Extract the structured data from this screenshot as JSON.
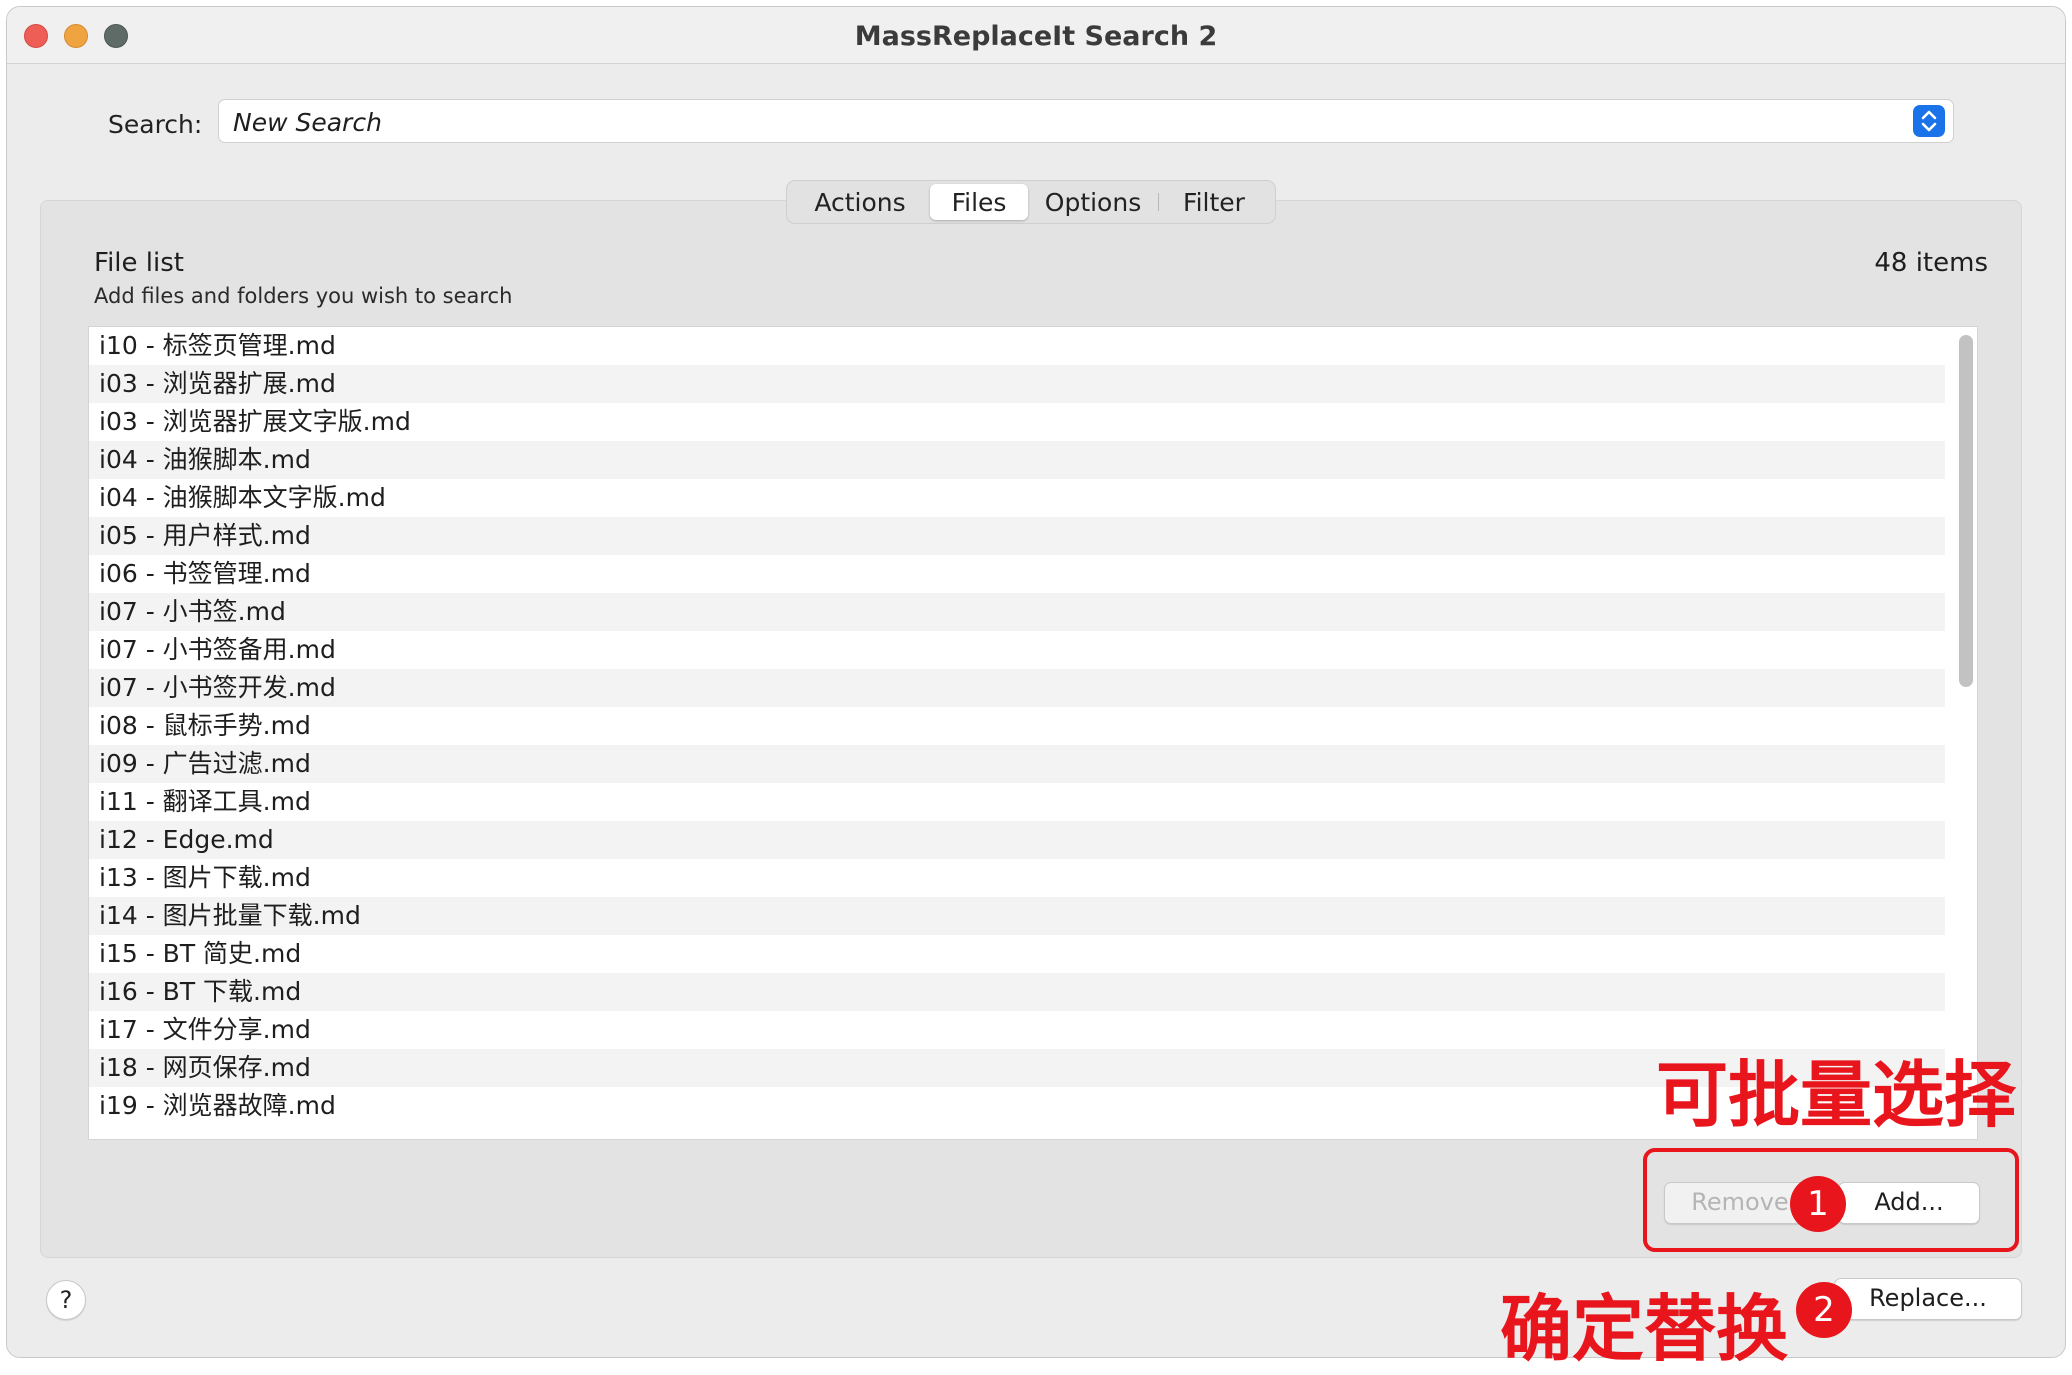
{
  "window": {
    "title": "MassReplaceIt Search 2"
  },
  "search": {
    "label": "Search:",
    "value": "New Search"
  },
  "tabs": [
    {
      "label": "Actions",
      "active": false
    },
    {
      "label": "Files",
      "active": true
    },
    {
      "label": "Options",
      "active": false
    },
    {
      "label": "Filter",
      "active": false
    }
  ],
  "file_list": {
    "title": "File list",
    "subtitle": "Add files and folders you wish to search",
    "count": "48 items",
    "items": [
      "i10 - 标签页管理.md",
      "i03 - 浏览器扩展.md",
      "i03 - 浏览器扩展文字版.md",
      "i04 - 油猴脚本.md",
      "i04 - 油猴脚本文字版.md",
      "i05 - 用户样式.md",
      "i06 - 书签管理.md",
      "i07 - 小书签.md",
      "i07 - 小书签备用.md",
      "i07 - 小书签开发.md",
      "i08 - 鼠标手势.md",
      "i09 - 广告过滤.md",
      "i11 - 翻译工具.md",
      "i12 - Edge.md",
      "i13 - 图片下载.md",
      "i14 - 图片批量下载.md",
      "i15 - BT 简史.md",
      "i16 - BT 下载.md",
      "i17 - 文件分享.md",
      "i18 - 网页保存.md",
      "i19 - 浏览器故障.md"
    ]
  },
  "buttons": {
    "remove": "Remove",
    "add": "Add...",
    "replace": "Replace...",
    "help": "?"
  },
  "annotations": {
    "batch_select": "可批量选择",
    "confirm_replace": "确定替换",
    "step1": "1",
    "step2": "2"
  },
  "colors": {
    "annotation_red": "#e8151c",
    "accent_blue": "#1a73e8"
  }
}
